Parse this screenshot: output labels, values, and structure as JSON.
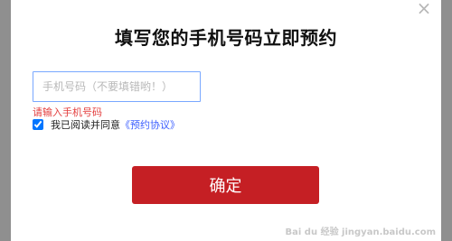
{
  "dialog": {
    "title": "填写您的手机号码立即预约",
    "close_glyph": "×",
    "phone_placeholder": "手机号码（不要填错哟！）",
    "error_text": "请输入手机号码",
    "agree_text": "我已阅读并同意",
    "agree_link": "《预约协议》",
    "agree_checked": true,
    "confirm_label": "确定"
  },
  "watermark": "Bai du 经验 jingyan.baidu.com"
}
